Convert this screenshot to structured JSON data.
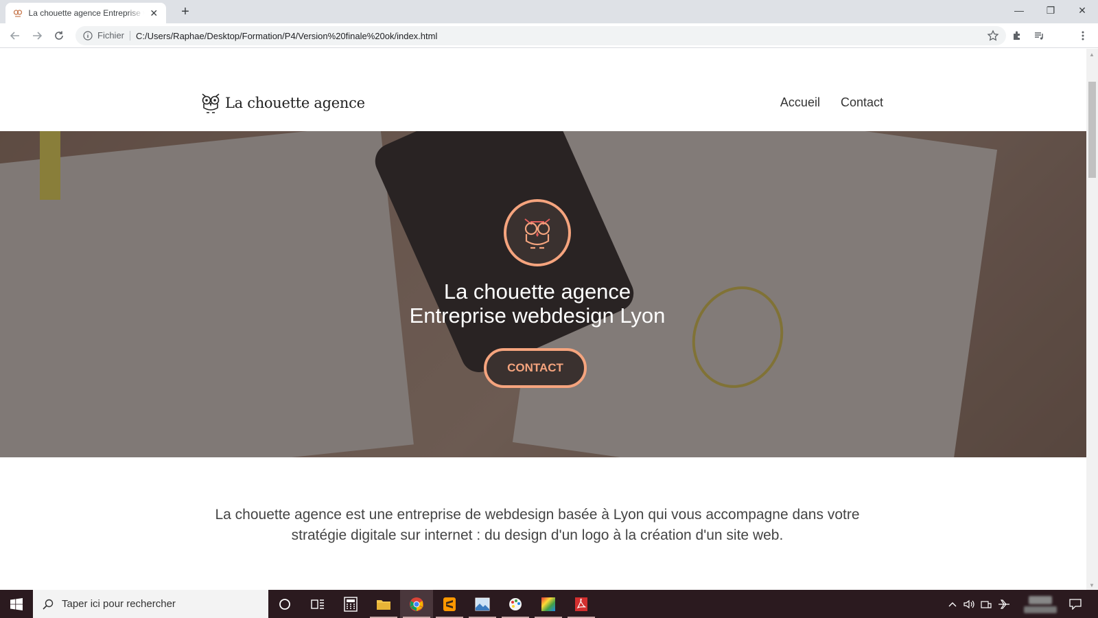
{
  "browser": {
    "tab_title": "La chouette agence Entreprise webdesign Lyon",
    "scheme_label": "Fichier",
    "url": "C:/Users/Raphae/Desktop/Formation/P4/Version%20finale%20ok/index.html"
  },
  "site": {
    "logo_text": "La chouette agence",
    "nav": [
      "Accueil",
      "Contact"
    ],
    "hero_title_line1": "La chouette agence",
    "hero_title_line2": "Entreprise webdesign Lyon",
    "hero_button": "CONTACT",
    "intro_line1": "La chouette agence est une entreprise de webdesign basée à Lyon qui vous accompagne dans votre",
    "intro_line2": "stratégie digitale sur internet : du design d'un logo à la création d'un site web."
  },
  "taskbar": {
    "search_placeholder": "Taper ici pour rechercher",
    "apps": [
      "cortana-icon",
      "task-view-icon",
      "calculator-icon",
      "file-explorer-icon",
      "chrome-icon",
      "sublime-text-icon",
      "photos-icon",
      "paint-icon",
      "color-app-icon",
      "acrobat-icon"
    ]
  },
  "colors": {
    "accent": "#f5a47e",
    "dark": "#3a312f",
    "taskbar": "#2b1a1f"
  }
}
